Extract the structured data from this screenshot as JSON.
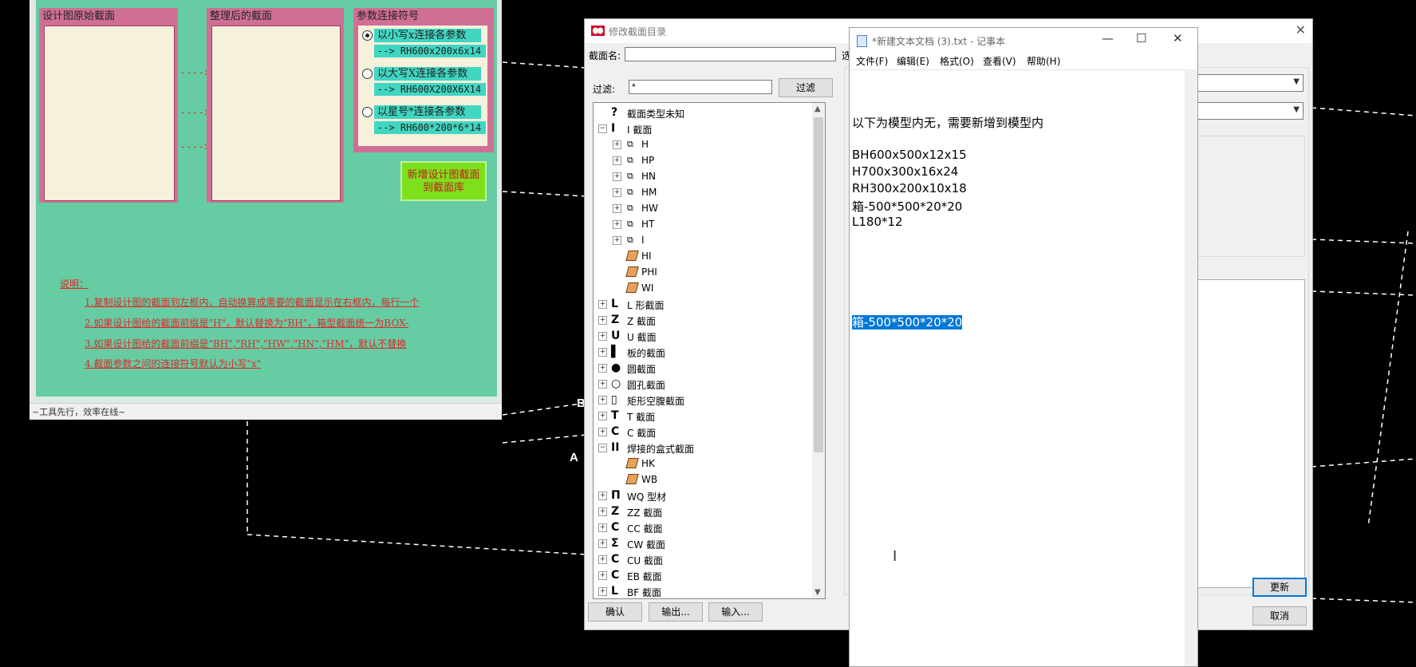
{
  "tool": {
    "group1_title": "设计图原始截面",
    "group2_title": "整理后的截面",
    "group3_title": "参数连接符号",
    "arrows": [
      "---->",
      "---->",
      "---->"
    ],
    "options": [
      {
        "label": "以小写x连接各参数",
        "example": "--> RH600x200x6x14",
        "selected": true
      },
      {
        "label": "以大写X连接各参数",
        "example": "--> RH600X200X6X14",
        "selected": false
      },
      {
        "label": "以星号*连接各参数",
        "example": "--> RH600*200*6*14",
        "selected": false
      }
    ],
    "add_button_line1": "新增设计图截面",
    "add_button_line2": "到截面库",
    "notes_title": "说明：",
    "notes": [
      "1.复制设计图的截面到左框内，自动换算成需要的截面显示在右框内，每行一个",
      "2.如果设计图给的截面前缀是\"H\"，默认替换为\"BH\"，箱型截面统一为BOX-",
      "3.如果设计图给的截面前缀是\"BH\",\"RH\",\"HW\",\"HN\",\"HM\"，默认不替换",
      "4.截面参数之间的连接符号默认为小写\"x\""
    ],
    "status": "~工具先行，效率在线~"
  },
  "dialog": {
    "title": "修改截面目录",
    "name_label": "截面名:",
    "name_value": "",
    "filter_label": "过滤:",
    "filter_value": "*",
    "filter_button": "过滤",
    "tab_stub": "选",
    "tree": [
      {
        "text": "截面类型未知",
        "icon": "?",
        "level": 0,
        "toggle": ""
      },
      {
        "text": "I 截面",
        "icon": "I",
        "level": 0,
        "toggle": "−"
      },
      {
        "text": "H",
        "icon": "par",
        "level": 1,
        "toggle": "+"
      },
      {
        "text": "HP",
        "icon": "par",
        "level": 1,
        "toggle": "+"
      },
      {
        "text": "HN",
        "icon": "par",
        "level": 1,
        "toggle": "+"
      },
      {
        "text": "HM",
        "icon": "par",
        "level": 1,
        "toggle": "+"
      },
      {
        "text": "HW",
        "icon": "par",
        "level": 1,
        "toggle": "+"
      },
      {
        "text": "HT",
        "icon": "par",
        "level": 1,
        "toggle": "+"
      },
      {
        "text": "I",
        "icon": "par",
        "level": 1,
        "toggle": "+"
      },
      {
        "text": "HI",
        "icon": "beam",
        "level": 1,
        "toggle": ""
      },
      {
        "text": "PHI",
        "icon": "beam",
        "level": 1,
        "toggle": ""
      },
      {
        "text": "WI",
        "icon": "beam",
        "level": 1,
        "toggle": ""
      },
      {
        "text": "L 形截面",
        "icon": "L",
        "level": 0,
        "toggle": "+"
      },
      {
        "text": "Z 截面",
        "icon": "Z",
        "level": 0,
        "toggle": "+"
      },
      {
        "text": "U 截面",
        "icon": "U",
        "level": 0,
        "toggle": "+"
      },
      {
        "text": "板的截面",
        "icon": "▌",
        "level": 0,
        "toggle": "+"
      },
      {
        "text": "圆截面",
        "icon": "●",
        "level": 0,
        "toggle": "+"
      },
      {
        "text": "圆孔截面",
        "icon": "○",
        "level": 0,
        "toggle": "+"
      },
      {
        "text": "矩形空腹截面",
        "icon": "▯",
        "level": 0,
        "toggle": "+"
      },
      {
        "text": "T 截面",
        "icon": "T",
        "level": 0,
        "toggle": "+"
      },
      {
        "text": "C 截面",
        "icon": "C",
        "level": 0,
        "toggle": "+"
      },
      {
        "text": "焊接的盒式截面",
        "icon": "II",
        "level": 0,
        "toggle": "−"
      },
      {
        "text": "HK",
        "icon": "beam",
        "level": 1,
        "toggle": ""
      },
      {
        "text": "WB",
        "icon": "beam",
        "level": 1,
        "toggle": ""
      },
      {
        "text": "WQ 型材",
        "icon": "Π",
        "level": 0,
        "toggle": "+"
      },
      {
        "text": "ZZ 截面",
        "icon": "Z",
        "level": 0,
        "toggle": "+"
      },
      {
        "text": "CC 截面",
        "icon": "C",
        "level": 0,
        "toggle": "+"
      },
      {
        "text": "CW 截面",
        "icon": "Σ",
        "level": 0,
        "toggle": "+"
      },
      {
        "text": "CU 截面",
        "icon": "C",
        "level": 0,
        "toggle": "+"
      },
      {
        "text": "EB 截面",
        "icon": "C",
        "level": 0,
        "toggle": "+"
      },
      {
        "text": "BF 截面",
        "icon": "L",
        "level": 0,
        "toggle": "+"
      }
    ],
    "ok_button": "确认",
    "export_button": "输出...",
    "import_button": "输入...",
    "update_button": "更新",
    "cancel_button": "取消"
  },
  "notepad": {
    "title": "*新建文本文档 (3).txt - 记事本",
    "menu": [
      "文件(F)",
      "编辑(E)",
      "格式(O)",
      "查看(V)",
      "帮助(H)"
    ],
    "lines": [
      "以下为模型内无，需要新增到模型内",
      "",
      "BH600x500x12x15",
      "H700x300x16x24",
      "RH300x200x10x18",
      "箱-500*500*20*20",
      "L180*12"
    ],
    "selected_line": "箱-500*500*20*20"
  },
  "canvas_labels": [
    "B",
    "A"
  ]
}
